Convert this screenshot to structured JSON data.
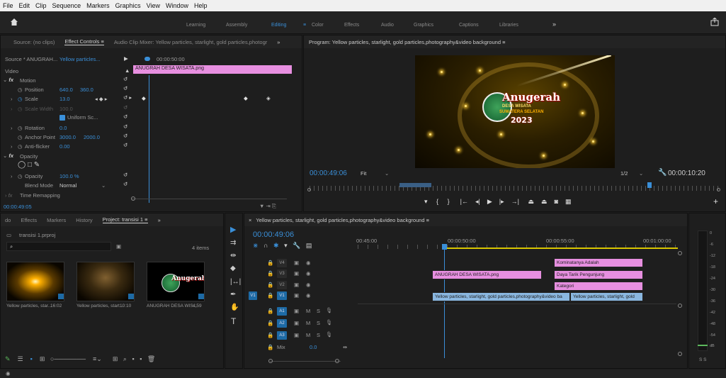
{
  "menu": [
    "File",
    "Edit",
    "Clip",
    "Sequence",
    "Markers",
    "Graphics",
    "View",
    "Window",
    "Help"
  ],
  "workspaces": [
    "Learning",
    "Assembly",
    "Editing",
    "Color",
    "Effects",
    "Audio",
    "Graphics",
    "Captions",
    "Libraries"
  ],
  "ws_more": "»",
  "source_panel": {
    "tabs": [
      "Source: (no clips)",
      "Effect Controls",
      "Audio Clip Mixer: Yellow particles, starlight, gold particles,photogr"
    ],
    "more": "»",
    "active": "Effect Controls ≡"
  },
  "effect_controls": {
    "source_label": "Source * ANUGRAH...",
    "clip_label": "Yellow particles...",
    "timecode": "00:00:50:00",
    "clip_name": "ANUGRAH DESA WISATA.png",
    "video": "Video",
    "motion": "Motion",
    "position_label": "Position",
    "position_x": "640.0",
    "position_y": "360.0",
    "scale_label": "Scale",
    "scale_val": "13.0",
    "scale_width_label": "Scale Width",
    "scale_width_val": "100.0",
    "uniform": "Uniform Sc...",
    "rotation_label": "Rotation",
    "rotation_val": "0.0",
    "anchor_label": "Anchor Point",
    "anchor_x": "3000.0",
    "anchor_y": "2000.0",
    "antiflicker_label": "Anti-flicker",
    "antiflicker_val": "0.00",
    "opacity_section": "Opacity",
    "opacity_label": "Opacity",
    "opacity_val": "100.0 %",
    "blend_label": "Blend Mode",
    "blend_val": "Normal",
    "time_remap": "Time Remapping",
    "bottom_tc": "00:00:49:05"
  },
  "program": {
    "title": "Program: Yellow particles, starlight, gold particles,photography&video background ≡",
    "timecode": "00:00:49:06",
    "fit": "Fit",
    "res": "1/2",
    "duration": "00:00:10:20",
    "logo": {
      "l1": "Anugerah",
      "l2": "DESA WISATA",
      "l3": "SUMATERA SELATAN",
      "l4": "2023"
    }
  },
  "project": {
    "tabs": [
      "Effects",
      "Markers",
      "History",
      "Project: transisi 1 ≡"
    ],
    "more": "»",
    "file": "transisi 1.prproj",
    "items_count": "4 items",
    "thumbs": [
      {
        "name": "Yellow particles, star...",
        "dur": "16:02"
      },
      {
        "name": "Yellow particles, start...",
        "dur": "10:10"
      },
      {
        "name": "ANUGRAH DESA WIS...",
        "dur": "4;59"
      }
    ]
  },
  "timeline": {
    "title": "Yellow particles, starlight, gold particles,photography&video background ≡",
    "timecode": "00:00:49:06",
    "ruler": [
      "00:45:00",
      "00:00:50:00",
      "00:00:55:00",
      "00:01:00:00"
    ],
    "tracks": [
      "V4",
      "V3",
      "V2",
      "V1",
      "A1",
      "A2",
      "A3"
    ],
    "mix_label": "Mix",
    "mix_val": "0.0",
    "clips": {
      "v3": "ANUGRAH DESA WISATA.png",
      "v1a": "Yellow particles, starlight, gold particles,photography&video ba",
      "v1b": "Yellow particles, starlight, gold",
      "v4": "Kominatanya Adalah",
      "v3b": "Daya Tarik Pengunjung",
      "v2": "Kategori"
    }
  },
  "meter": {
    "labels": [
      "0",
      "-6",
      "-12",
      "-18",
      "-24",
      "-30",
      "-36",
      "-42",
      "-48",
      "-54",
      "dB"
    ],
    "solo": "S S"
  }
}
